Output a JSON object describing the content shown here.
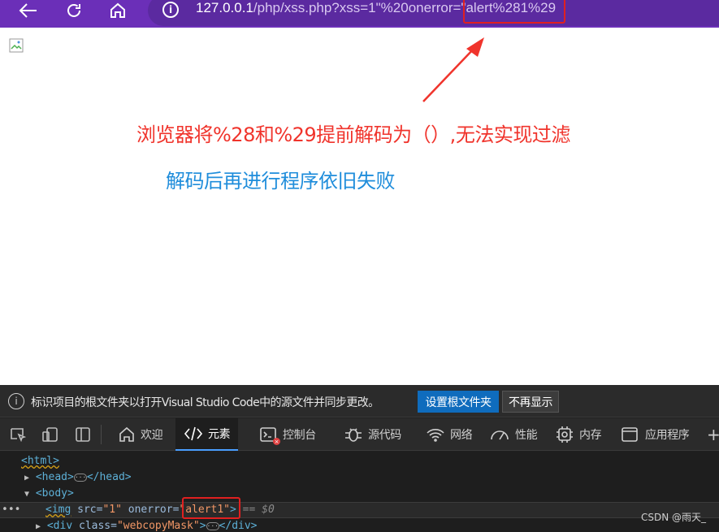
{
  "browser": {
    "url_host": "127.0.0.1",
    "url_path": "/php/xss.php?xss=1\"%20onerror=\"",
    "url_highlighted": "alert%281%29"
  },
  "page": {
    "note_red": "浏览器将%28和%29提前解码为（）,无法实现过滤",
    "note_blue": "解码后再进行程序依旧失败"
  },
  "devtools": {
    "info_bar": {
      "message": "标识项目的根文件夹以打开Visual Studio Code中的源文件并同步更改。",
      "primary_button": "设置根文件夹",
      "secondary_button": "不再显示"
    },
    "tabs": [
      {
        "label": "欢迎",
        "icon": "home-icon"
      },
      {
        "label": "元素",
        "icon": "code-icon",
        "active": true
      },
      {
        "label": "控制台",
        "icon": "console-icon"
      },
      {
        "label": "源代码",
        "icon": "bug-icon"
      },
      {
        "label": "网络",
        "icon": "wifi-icon"
      },
      {
        "label": "性能",
        "icon": "gauge-icon"
      },
      {
        "label": "内存",
        "icon": "chip-icon"
      },
      {
        "label": "应用程序",
        "icon": "window-icon"
      }
    ],
    "dom": {
      "html_open": "<html>",
      "head_open": "<head>",
      "head_close": "</head>",
      "body_open": "<body>",
      "img_tag": "<img",
      "img_src_attr": "src",
      "img_src_val": "\"1\"",
      "img_onerror_attr": "onerror",
      "img_onerror_val": "\"alert1\"",
      "img_close": ">",
      "selected_marker": "== $0",
      "div_open": "<div",
      "div_class_attr": "class",
      "div_class_val": "\"webcopyMask\"",
      "div_close": "</div>"
    }
  },
  "watermark": "CSDN @雨天_"
}
